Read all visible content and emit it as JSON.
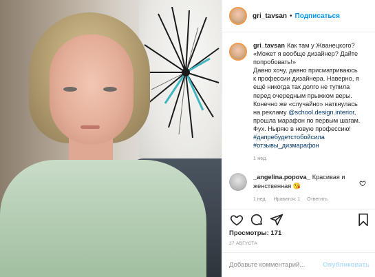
{
  "post": {
    "username": "gri_tavsan",
    "follow_label": "Подписаться",
    "separator": "•"
  },
  "caption": {
    "username": "gri_tavsan",
    "lines": [
      "Как там у Жванецкого?",
      "«Может я вообще дизайнер? Дайте",
      "попробовать!»",
      "Давно хочу, давно присматриваюсь",
      "к профессии дизайнера. Наверно, я",
      "ещё никогда так долго не тупила",
      "перед очередным прыжком веры.",
      "Конечно же «случайно» наткнулась",
      "на рекламу"
    ],
    "mention": "@school.design.interior",
    "after_mention": ",",
    "lines2": [
      "прошла марафон по первым шагам.",
      "Фух. Ныряю в новую профессию!"
    ],
    "hashtags": [
      "#дапребудетстобойсила",
      "#отзывы_дизмарафон"
    ],
    "time": "1 нед."
  },
  "comment": {
    "username": "_angelina.popova_",
    "text": "Красивая и женственная",
    "emoji": "😘",
    "time": "1 нед.",
    "likes": "Нравится: 1",
    "reply": "Ответить"
  },
  "actions": {
    "like_icon": "heart-icon",
    "comment_icon": "comment-icon",
    "share_icon": "share-icon",
    "save_icon": "bookmark-icon"
  },
  "views": "Просмотры: 171",
  "date": "27 АВГУСТА",
  "add_comment": {
    "placeholder": "Добавьте комментарий...",
    "publish": "Опубликовать"
  },
  "colors": {
    "link": "#00376b",
    "follow": "#0095f6",
    "publish_disabled": "#b2dffc"
  }
}
